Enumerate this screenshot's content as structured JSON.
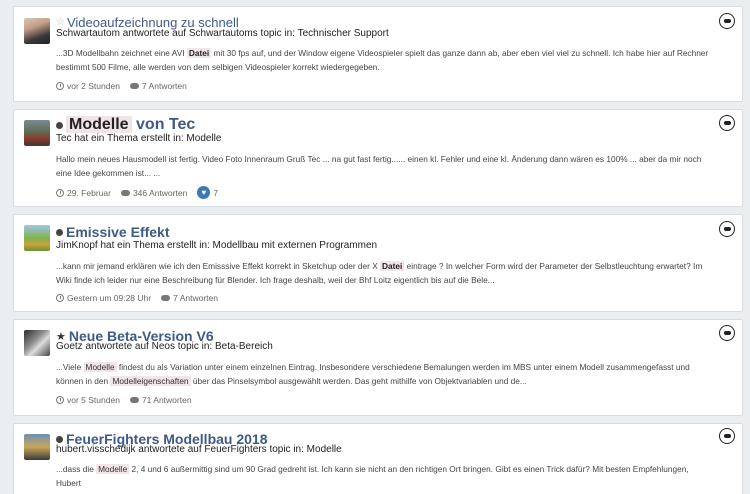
{
  "posts": [
    {
      "title": "Videoaufzeichnung zu schnell",
      "meta": "Schwartautom antwortete auf Schwartautoms topic in: Technischer Support",
      "snippet_parts": [
        "...3D Modellbahn zeichnet eine AVI ",
        "Datei",
        " mit 30 fps auf, und der Window eigene Videospieler spielt das ganze dann ab, aber eben viel viel zu schnell. Ich habe hier auf Rechner bestimmt 500 Filme, alle werden von dem selbigen Videospieler korrekt wiedergegeben."
      ],
      "time": "vor 2 Stunden",
      "replies": "7 Antworten"
    },
    {
      "title_hl": "Modelle",
      "title_rest": "von Tec",
      "meta": "Tec hat ein Thema erstellt in: Modelle",
      "snippet": "Hallo mein neues Hausmodell ist fertig. Video Foto Innenraum Gruß Tec ... na gut fast fertig...... einen kl. Fehler und eine kl. Änderung dann wären es 100% ... aber da mir noch eine Idee gekommen ist... ...",
      "time": "29. Februar",
      "replies": "346 Antworten",
      "likes": "7"
    },
    {
      "title": "Emissive Effekt",
      "meta": "JimKnopf hat ein Thema erstellt in: Modellbau mit externen Programmen",
      "snippet_parts": [
        "...kann mir jemand erklären wie ich den Emisssive Effekt korrekt in Sketchup oder der X ",
        "Datei",
        " eintrage ? In welcher Form wird der Parameter der Selbstleuchtung erwartet? Im Wiki finde ich leider nur eine Beschreibung für Blender. Ich frage deshalb, weil der Bhf Loitz eigentlich bis auf die Bele..."
      ],
      "time": "Gestern um 09:28 Uhr",
      "replies": "7 Antworten"
    },
    {
      "title": "Neue Beta-Version V6",
      "meta": "Goetz antwortete auf Neos topic in: Beta-Bereich",
      "snippet_parts": [
        "...Viele ",
        "Modelle",
        " findest du als Variation unter einem einzelnen Eintrag. Insbesondere verschiedene Bemalungen werden im MBS unter einem Modell zusammengefasst und können in den ",
        "Modelleigenschaften",
        " über das Pinselsymbol ausgewählt werden. Das geht mithilfe von Objektvariablen und de..."
      ],
      "time": "vor 5 Stunden",
      "replies": "71 Antworten"
    },
    {
      "title": "FeuerFighters Modellbau 2018",
      "meta": "hubert.visschedijk antwortete auf FeuerFighters topic in: Modelle",
      "snippet_parts": [
        "...dass die ",
        "Modelle",
        " 2, 4 und 6 außermittig sind um 90 Grad gedreht ist. Ich kann sie nicht an den richtigen Ort bringen. Gibt es einen Trick dafür? Mit besten Empfehlungen, Hubert"
      ]
    }
  ]
}
